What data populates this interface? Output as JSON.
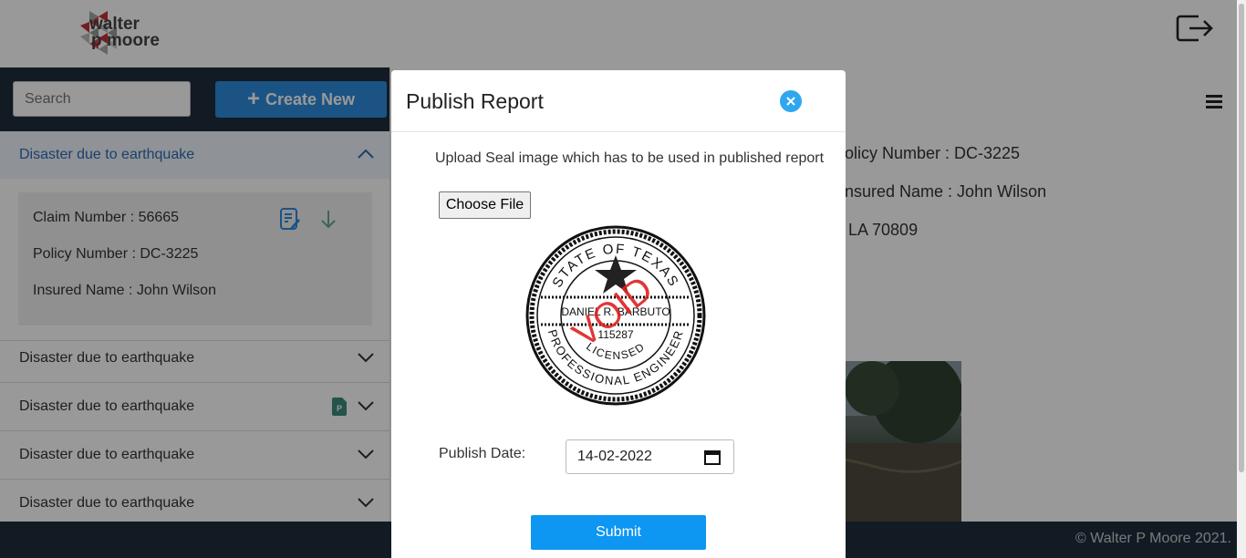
{
  "header": {
    "logo_line1": "walter",
    "logo_line2": "p moore"
  },
  "sidebar": {
    "search_placeholder": "Search",
    "create_label": "Create New",
    "items": [
      {
        "title": "Disaster due to earthquake",
        "expanded": true,
        "claim": "Claim Number : 56665",
        "policy": "Policy Number : DC-3225",
        "insured": "Insured Name : John Wilson"
      },
      {
        "title": "Disaster due to earthquake",
        "expanded": false
      },
      {
        "title": "Disaster due to earthquake",
        "expanded": false,
        "has_pdf": true
      },
      {
        "title": "Disaster due to earthquake",
        "expanded": false
      },
      {
        "title": "Disaster due to earthquake",
        "expanded": false
      }
    ]
  },
  "main": {
    "policy": "olicy Number : DC-3225",
    "insured": "nsured Name : John Wilson",
    "address": "LA 70809"
  },
  "modal": {
    "title": "Publish Report",
    "upload_text": "Upload Seal image which has to be used in published report",
    "choose_label": "Choose File",
    "date_label": "Publish Date:",
    "date_value": "14-02-2022",
    "submit_label": "Submit"
  },
  "seal": {
    "top_arc": "STATE OF TEXAS",
    "name": "DANIEL R. BARBUTO",
    "number": "115287",
    "bottom_arc": "PROFESSIONAL ENGINEER",
    "licensed": "LICENSED",
    "void": "VOID"
  },
  "footer": {
    "copyright": "© Walter P Moore 2021."
  },
  "colors": {
    "primary": "#2d8bdc",
    "dark": "#1e2d3d",
    "submit": "#0d96f2",
    "icon_teal": "#5fa89a",
    "void_red": "#e02020"
  }
}
